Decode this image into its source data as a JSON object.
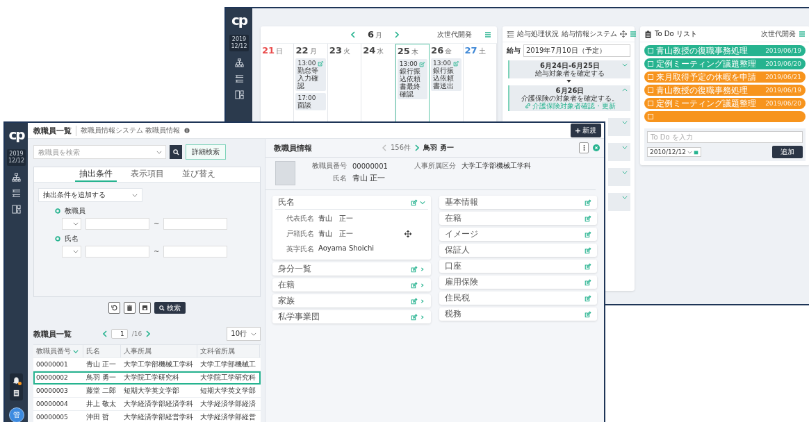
{
  "back_window": {
    "sidebar": {
      "logo": "cp",
      "year": "2019",
      "day": "12/12"
    },
    "calendar": {
      "month": "6",
      "month_unit": "月",
      "group": "次世代開発",
      "days": [
        {
          "date": "21",
          "weekday": "日",
          "kind": "sun",
          "selected": false
        },
        {
          "date": "22",
          "weekday": "月",
          "kind": "weekday",
          "selected": false,
          "events": [
            {
              "time": "13:00",
              "title": "勤怠等入力確認",
              "editable": true
            },
            {
              "time": "17:00",
              "title": "面談",
              "editable": false
            }
          ]
        },
        {
          "date": "23",
          "weekday": "火",
          "kind": "weekday",
          "selected": false
        },
        {
          "date": "24",
          "weekday": "水",
          "kind": "weekday",
          "selected": false
        },
        {
          "date": "25",
          "weekday": "木",
          "kind": "weekday",
          "selected": true,
          "events": [
            {
              "time": "13:00",
              "title": "銀行振込依頼書最終確認",
              "editable": true
            }
          ]
        },
        {
          "date": "26",
          "weekday": "金",
          "kind": "weekday",
          "selected": false,
          "events": [
            {
              "time": "13:00",
              "title": "銀行振込依頼書送出",
              "editable": true
            }
          ]
        },
        {
          "date": "27",
          "weekday": "土",
          "kind": "sat",
          "selected": false
        }
      ]
    },
    "payroll": {
      "title": "給与処理状況",
      "system": "給与情報システム",
      "pay_label": "給与",
      "pay_date": "2019年7月10日（予定）",
      "steps": [
        {
          "date": "6月24日-6月25日",
          "task": "給与対象者を確定する",
          "expanded": false
        },
        {
          "date": "6月26日",
          "task": "介護保険の対象者を確定する。",
          "link": "介護保険対象者確認・更新",
          "expanded": true
        },
        {
          "expanded": false
        },
        {
          "expanded": false
        },
        {
          "expanded": false
        },
        {
          "expanded": false
        }
      ]
    },
    "todo": {
      "title": "To Do リスト",
      "group": "次世代開発",
      "items": [
        {
          "label": "青山教授の復職事務処理",
          "date": "2019/06/19",
          "color": "#26b38f",
          "checked": false
        },
        {
          "label": "定例ミーティング議題整理",
          "date": "2019/06/20",
          "color": "#26b38f",
          "checked": false
        },
        {
          "label": "来月取得予定の休暇を申請",
          "date": "2019/06/21",
          "color": "#f7941d",
          "checked": false
        },
        {
          "label": "青山教授の復職事務処理",
          "date": "2019/06/19",
          "color": "#f7941d",
          "checked": false
        },
        {
          "label": "定例ミーティング議題整理",
          "date": "2019/06/20",
          "color": "#f7941d",
          "checked": false
        },
        {
          "color": "#f7941d",
          "checked": false
        }
      ],
      "placeholder": "To Do を入力",
      "date_value": "2010/12/12",
      "add_button": "追加"
    }
  },
  "front_window": {
    "sidebar": {
      "logo": "cp",
      "year": "2019",
      "day": "12/12",
      "alert": true,
      "avatar": "管"
    },
    "header": {
      "title": "教職員一覧",
      "breadcrumb": "教職員情報システム 教職員情報",
      "new_button": "新規"
    },
    "search": {
      "placeholder": "教職員を検索",
      "advanced_button": "詳細検索"
    },
    "filter": {
      "tabs": [
        {
          "label": "抽出条件",
          "selected": true
        },
        {
          "label": "表示項目",
          "selected": false
        },
        {
          "label": "並び替え",
          "selected": false
        }
      ],
      "add_condition": "抽出条件を追加する",
      "conditions": [
        {
          "label": "教職員",
          "separator": "~"
        },
        {
          "label": "氏名",
          "separator": "~"
        }
      ],
      "search_button": "検索"
    },
    "list": {
      "title": "教職員一覧",
      "page": "1",
      "page_total": "/16",
      "per_page": "10行",
      "columns": [
        {
          "label": "教職員番号",
          "sorted": true
        },
        {
          "label": "氏名",
          "sorted": false
        },
        {
          "label": "人事所属",
          "sorted": false
        },
        {
          "label": "文科省所属",
          "sorted": false
        }
      ],
      "rows": [
        {
          "cells": [
            "00000001",
            "青山 正一",
            "大学工学部機械工学科",
            "大学工学部機械工"
          ],
          "selected": false
        },
        {
          "cells": [
            "00000002",
            "鳥羽 勇一",
            "大学院工学研究科",
            "大学院工学研究科"
          ],
          "selected": true
        },
        {
          "cells": [
            "00000003",
            "藤堂 二郎",
            "短期大学英文学部",
            "短期大学英文学部"
          ],
          "selected": false
        },
        {
          "cells": [
            "00000004",
            "井上 敬太",
            "大学経済学部経済学科",
            "大学経済学部経済"
          ],
          "selected": false
        },
        {
          "cells": [
            "00000005",
            "沖田 哲",
            "大学経済学部経営学科",
            "大学経済学部経営"
          ],
          "selected": false
        }
      ]
    },
    "detail": {
      "title": "教職員情報",
      "count": "156件",
      "current": "鳥羽 勇一",
      "profile": [
        {
          "label": "教職員番号",
          "value": "00000001"
        },
        {
          "label": "人事所属区分",
          "value": "大学工学部機械工学科"
        },
        {
          "label": "氏名",
          "value": "青山 正一"
        }
      ],
      "sections_left": [
        {
          "title": "氏名",
          "expanded": true,
          "fields": [
            {
              "label": "代表氏名",
              "value": "青山　正一"
            },
            {
              "label": "戸籍氏名",
              "value": "青山　正一"
            },
            {
              "label": "英字氏名",
              "value": "Aoyama Shoichi"
            }
          ]
        },
        {
          "title": "身分一覧",
          "expanded": false
        },
        {
          "title": "在籍",
          "expanded": false
        },
        {
          "title": "家族",
          "expanded": false
        },
        {
          "title": "私学事業団",
          "expanded": false
        }
      ],
      "sections_right": [
        {
          "title": "基本情報"
        },
        {
          "title": "在籍"
        },
        {
          "title": "イメージ"
        },
        {
          "title": "保証人"
        },
        {
          "title": "口座"
        },
        {
          "title": "雇用保険"
        },
        {
          "title": "住民税"
        },
        {
          "title": "税務"
        }
      ]
    }
  }
}
